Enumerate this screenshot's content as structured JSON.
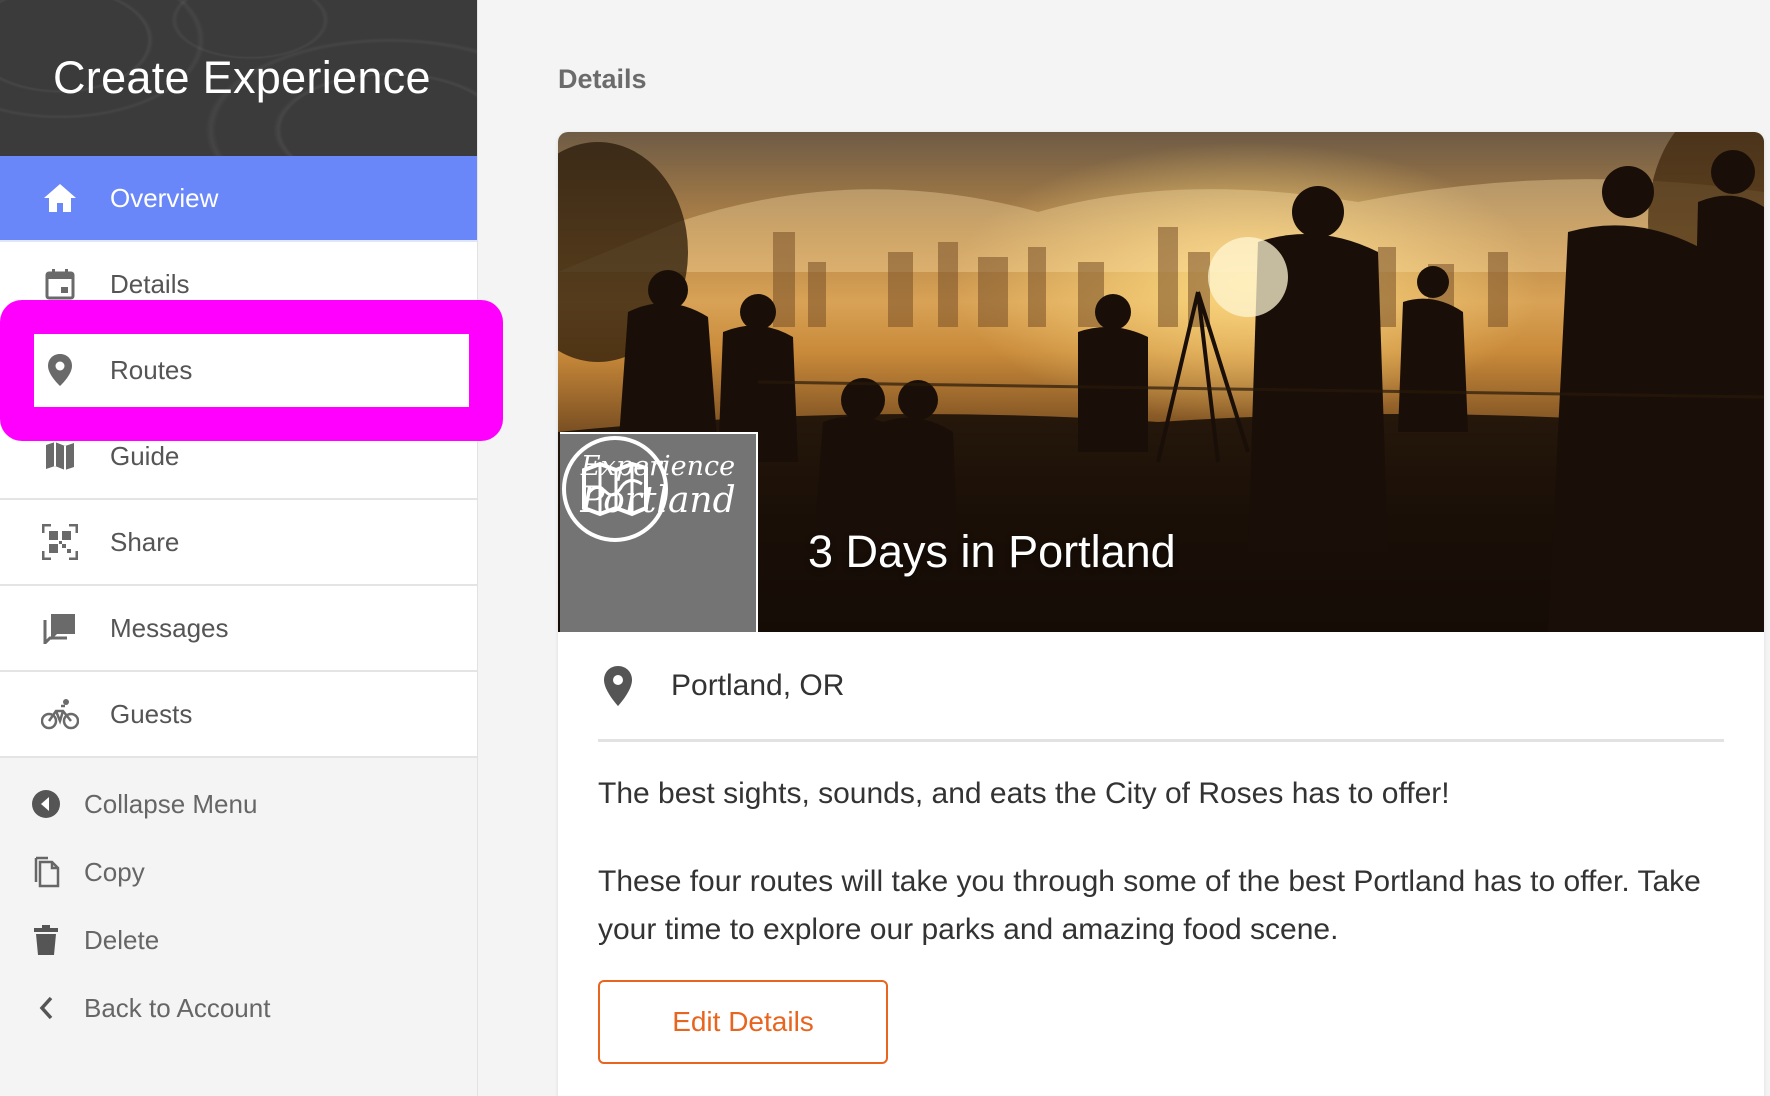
{
  "sidebar": {
    "title": "Create Experience",
    "nav_items": [
      {
        "label": "Overview",
        "icon": "home-icon"
      },
      {
        "label": "Details",
        "icon": "calendar-icon"
      },
      {
        "label": "Routes",
        "icon": "map-pin-icon"
      },
      {
        "label": "Guide",
        "icon": "map-icon"
      },
      {
        "label": "Share",
        "icon": "qr-code-icon"
      },
      {
        "label": "Messages",
        "icon": "chat-icon"
      },
      {
        "label": "Guests",
        "icon": "bicycle-icon"
      }
    ],
    "active_item": "Overview",
    "highlighted_item": "Routes",
    "secondary_items": [
      {
        "label": "Collapse Menu",
        "icon": "collapse-left-icon"
      },
      {
        "label": "Copy",
        "icon": "copy-icon"
      },
      {
        "label": "Delete",
        "icon": "trash-icon"
      },
      {
        "label": "Back to Account",
        "icon": "chevron-left-icon"
      }
    ]
  },
  "main": {
    "section_title": "Details",
    "card": {
      "hero_title": "3 Days in Portland",
      "logo": {
        "line1": "Experience",
        "line2": "Portland"
      },
      "location": "Portland, OR",
      "description": [
        "The best sights, sounds, and eats the City of Roses has to offer!",
        "These four routes will take you through some of the best Portland has to offer. Take your time to explore our parks and amazing food scene."
      ],
      "edit_button": "Edit Details"
    }
  },
  "colors": {
    "active_nav": "#6a87f9",
    "accent": "#e8651f",
    "annotation": "#ff00ff",
    "header_bg": "#3b3b3b"
  }
}
